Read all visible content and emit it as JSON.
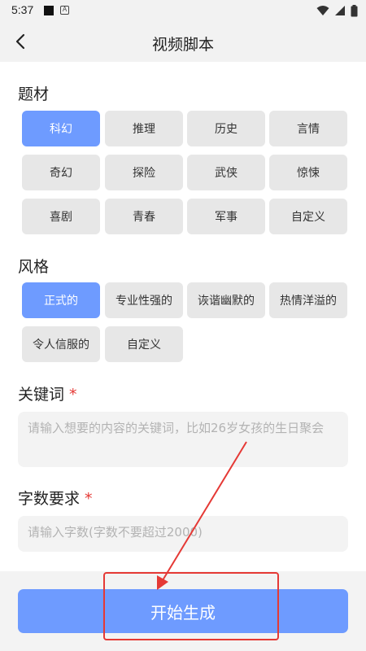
{
  "status_bar": {
    "time": "5:37",
    "notif_letter": "A"
  },
  "header": {
    "title": "视频脚本"
  },
  "subject": {
    "label": "题材",
    "options": [
      "科幻",
      "推理",
      "历史",
      "言情",
      "奇幻",
      "探险",
      "武侠",
      "惊悚",
      "喜剧",
      "青春",
      "军事",
      "自定义"
    ],
    "selected": "科幻"
  },
  "style": {
    "label": "风格",
    "options": [
      "正式的",
      "专业性强的",
      "诙谐幽默的",
      "热情洋溢的",
      "令人信服的",
      "自定义"
    ],
    "selected": "正式的"
  },
  "keywords": {
    "label": "关键词",
    "required_mark": "*",
    "placeholder": "请输入想要的内容的关键词，比如26岁女孩的生日聚会"
  },
  "word_count": {
    "label": "字数要求",
    "required_mark": "*",
    "placeholder": "请输入字数(字数不要超过2000)"
  },
  "action": {
    "start_label": "开始生成"
  },
  "colors": {
    "accent": "#6e9bff",
    "chip_bg": "#e7e7e7",
    "annotation": "#e53935"
  }
}
